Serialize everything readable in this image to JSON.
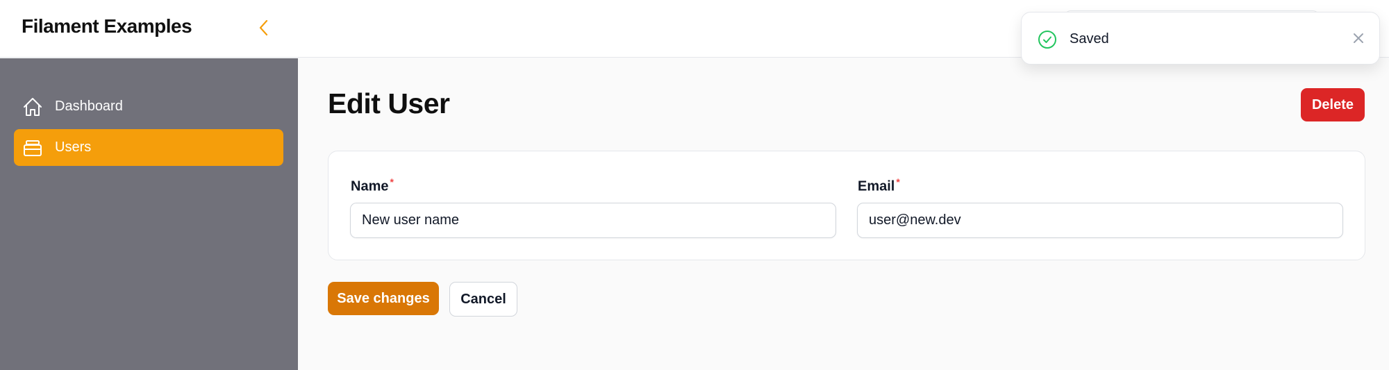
{
  "app": {
    "brand": "Filament Examples"
  },
  "sidebar": {
    "items": [
      {
        "label": "Dashboard",
        "icon": "home-icon",
        "active": false
      },
      {
        "label": "Users",
        "icon": "archive-box-icon",
        "active": true
      }
    ],
    "active_color": "#f59e0b",
    "background": "#71717a"
  },
  "page": {
    "title": "Edit User"
  },
  "header_actions": {
    "delete_label": "Delete"
  },
  "form": {
    "name": {
      "label": "Name",
      "required_mark": "*",
      "value": "New user name"
    },
    "email": {
      "label": "Email",
      "required_mark": "*",
      "value": "user@new.dev"
    }
  },
  "actions": {
    "save_label": "Save changes",
    "cancel_label": "Cancel"
  },
  "notification": {
    "text": "Saved",
    "icon": "check-circle-icon",
    "close_icon": "x-mark-icon"
  },
  "colors": {
    "primary": "#d97706",
    "danger": "#dc2626",
    "success": "#22c55e"
  }
}
